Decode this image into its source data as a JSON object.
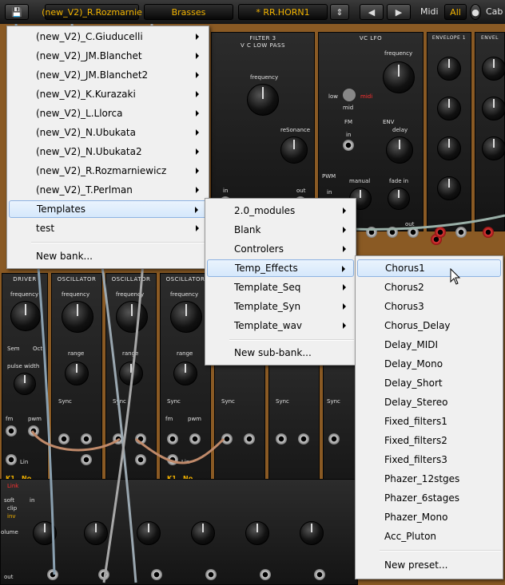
{
  "toolbar": {
    "bank_field": "(new_V2)_R.Rozmarnie",
    "category_field": "Brasses",
    "preset_field": "* RR.HORN1",
    "midi_label": "Midi",
    "midi_channel": "All",
    "cab_label": "Cab"
  },
  "rack": {
    "filter": {
      "title1": "FILTER 3",
      "title2": "V C LOW PASS",
      "frequency": "frequency",
      "resonance": "reSonance",
      "in": "in",
      "out": "out"
    },
    "lfo": {
      "title": "VC LFO",
      "frequency": "frequency",
      "low": "low",
      "midi": "midi",
      "mid": "mid",
      "fm": "FM",
      "in": "in",
      "env": "ENV",
      "delay": "delay",
      "pwm": "PWM",
      "manual": "manual",
      "fadein": "fade in",
      "in2": "in",
      "out": "out"
    },
    "env": {
      "title": "ENVELOPE 1",
      "title2": "ENVEL"
    },
    "lower": {
      "driver": "DRIVER",
      "osc": "OSCILLATOR",
      "frequency": "frequency",
      "range": "range",
      "sem": "Sem",
      "oct": "Oct",
      "pulse": "pulse width",
      "sync": "Sync",
      "fm": "fm",
      "pwm": "pwm",
      "lin": "Lin",
      "k1": "K1",
      "no": "No",
      "link": "Link",
      "soft": "soft",
      "in": "in",
      "clip": "clip",
      "inv": "inv",
      "volume": "olume",
      "out": "out"
    }
  },
  "menus": {
    "bank_menu": {
      "items": [
        "(new_V2)_C.Giuducelli",
        "(new_V2)_JM.Blanchet",
        "(new_V2)_JM.Blanchet2",
        "(new_V2)_K.Kurazaki",
        "(new_V2)_L.Llorca",
        "(new_V2)_N.Ubukata",
        "(new_V2)_N.Ubukata2",
        "(new_V2)_R.Rozmarniewicz",
        "(new_V2)_T.Perlman",
        "Templates",
        "test"
      ],
      "new_label": "New bank..."
    },
    "templates_menu": {
      "items": [
        "2.0_modules",
        "Blank",
        "Controlers",
        "Temp_Effects",
        "Template_Seq",
        "Template_Syn",
        "Template_wav"
      ],
      "new_label": "New sub-bank..."
    },
    "effects_menu": {
      "items": [
        "Chorus1",
        "Chorus2",
        "Chorus3",
        "Chorus_Delay",
        "Delay_MIDI",
        "Delay_Mono",
        "Delay_Short",
        "Delay_Stereo",
        "Fixed_filters1",
        "Fixed_filters2",
        "Fixed_filters3",
        "Phazer_12stges",
        "Phazer_6stages",
        "Phazer_Mono",
        "Acc_Pluton"
      ],
      "new_label": "New preset..."
    }
  },
  "colors": {
    "accent": "#f3b400",
    "menu_bg": "#f0f0f0",
    "highlight": "#d6e8fb",
    "wood": "#8a5a24"
  }
}
